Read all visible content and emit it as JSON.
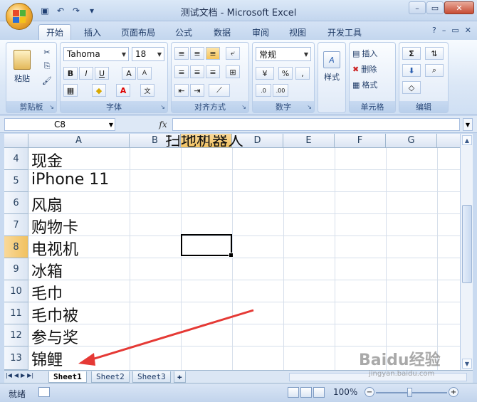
{
  "window": {
    "title": "测试文档 - Microsoft Excel"
  },
  "ribbon_tabs": [
    "开始",
    "插入",
    "页面布局",
    "公式",
    "数据",
    "审阅",
    "视图",
    "开发工具"
  ],
  "ribbon": {
    "clipboard": {
      "label": "剪贴板",
      "paste": "粘贴"
    },
    "font": {
      "label": "字体",
      "name": "Tahoma",
      "size": "18"
    },
    "alignment": {
      "label": "对齐方式"
    },
    "number": {
      "label": "数字",
      "format": "常规",
      "percent": "%",
      "comma": ","
    },
    "styles": {
      "label": "样式"
    },
    "cells": {
      "label": "单元格",
      "insert": "插入",
      "delete": "删除",
      "format": "格式"
    },
    "editing": {
      "label": "编辑",
      "sum": "Σ"
    }
  },
  "formula_bar": {
    "name_box": "C8",
    "fx": "fx",
    "value": ""
  },
  "columns": [
    "A",
    "B",
    "C",
    "D",
    "E",
    "F",
    "G"
  ],
  "selected_column": "C",
  "rows": [
    {
      "num": "4",
      "a": "现金"
    },
    {
      "num": "5",
      "a": "iPhone 11"
    },
    {
      "num": "6",
      "a": "风扇"
    },
    {
      "num": "7",
      "a": "购物卡"
    },
    {
      "num": "8",
      "a": "电视机"
    },
    {
      "num": "9",
      "a": "冰箱"
    },
    {
      "num": "10",
      "a": "毛巾"
    },
    {
      "num": "11",
      "a": "毛巾被"
    },
    {
      "num": "12",
      "a": "参与奖"
    },
    {
      "num": "13",
      "a": "锦鲤"
    }
  ],
  "overflow_text": "扫地机器人",
  "selected_row": "8",
  "sheets": [
    "Sheet1",
    "Sheet2",
    "Sheet3"
  ],
  "active_sheet": "Sheet1",
  "status": {
    "ready": "就绪",
    "zoom": "100%"
  },
  "watermark": {
    "brand": "Baidu经验",
    "url": "jingyan.baidu.com"
  },
  "colors": {
    "arrow": "#e53935",
    "selection_header": "#f5c96d",
    "accent": "#1e3a66"
  }
}
